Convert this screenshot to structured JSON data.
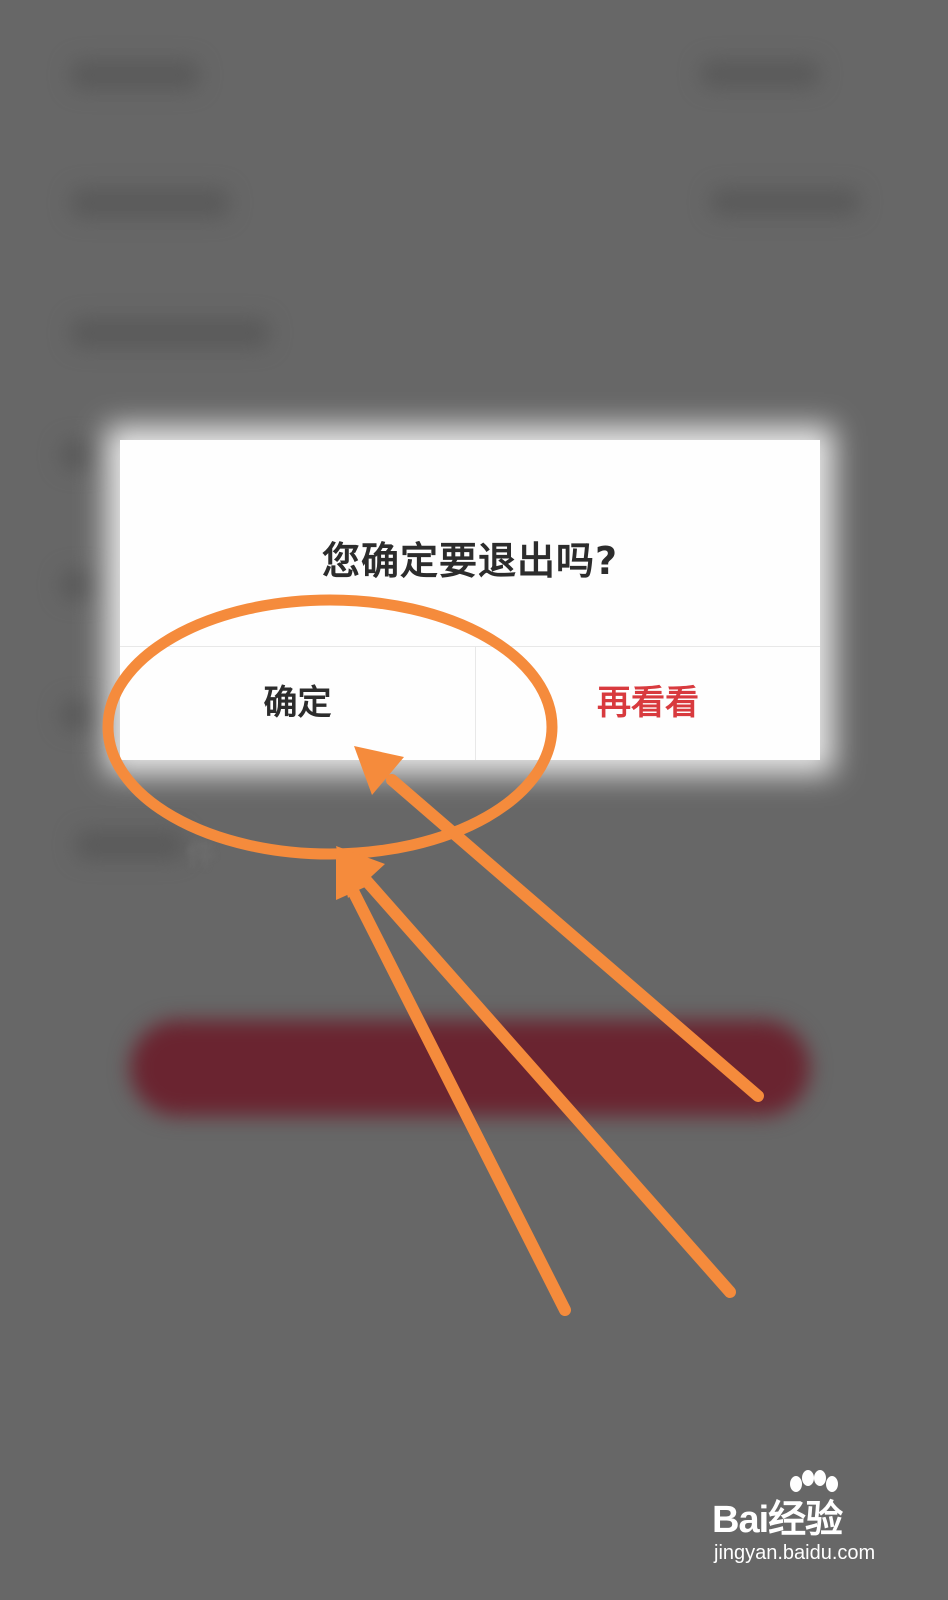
{
  "dialog": {
    "title": "您确定要退出吗?",
    "confirm_label": "确定",
    "cancel_label": "再看看"
  },
  "background": {
    "partial_text": "件"
  },
  "colors": {
    "overlay": "#676767",
    "dialog_bg": "#fefefe",
    "confirm_text": "#2c2c2c",
    "cancel_text": "#d83a3e",
    "annotation": "#f58b3c",
    "blurred_button": "#6a2430"
  },
  "watermark": {
    "brand": "Bai经验",
    "url": "jingyan.baidu.com"
  }
}
